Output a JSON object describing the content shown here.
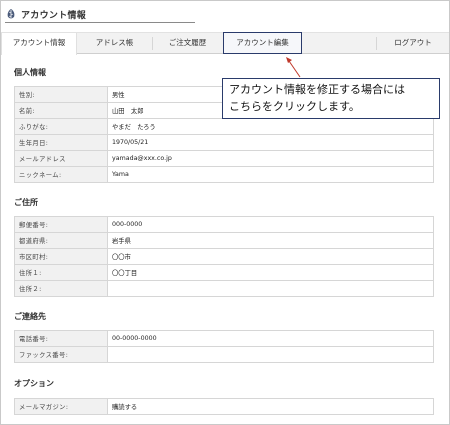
{
  "header": {
    "title": "アカウント情報",
    "logo_icon": "leaf-icon"
  },
  "tabs": [
    {
      "label": "アカウント情報"
    },
    {
      "label": "アドレス帳"
    },
    {
      "label": "ご注文履歴"
    },
    {
      "label": "アカウント編集"
    },
    {
      "label": "ログアウト"
    }
  ],
  "callout": {
    "line1": "アカウント情報を修正する場合には",
    "line2": "こちらをクリックします。",
    "accent": "#c0392b"
  },
  "personal": {
    "title": "個人情報",
    "rows": [
      {
        "label": "性別:",
        "value": "男性"
      },
      {
        "label": "名前:",
        "value": "山田　太郎"
      },
      {
        "label": "ふりがな:",
        "value": "やまだ　たろう"
      },
      {
        "label": "生年月日:",
        "value": "1970/05/21"
      },
      {
        "label": "メールアドレス",
        "value": "yamada@xxx.co.jp"
      },
      {
        "label": "ニックネーム:",
        "value": "Yama"
      }
    ]
  },
  "address": {
    "title": "ご住所",
    "rows": [
      {
        "label": "郵便番号:",
        "value": "000-0000"
      },
      {
        "label": "都道府県:",
        "value": "岩手県"
      },
      {
        "label": "市区町村:",
        "value": "〇〇市"
      },
      {
        "label": "住所１:",
        "value": "〇〇丁目"
      },
      {
        "label": "住所２:",
        "value": ""
      }
    ]
  },
  "contact": {
    "title": "ご連絡先",
    "rows": [
      {
        "label": "電話番号:",
        "value": "00-0000-0000"
      },
      {
        "label": "ファックス番号:",
        "value": ""
      }
    ]
  },
  "options": {
    "title": "オプション",
    "rows": [
      {
        "label": "メールマガジン:",
        "value": "購読する"
      }
    ]
  }
}
